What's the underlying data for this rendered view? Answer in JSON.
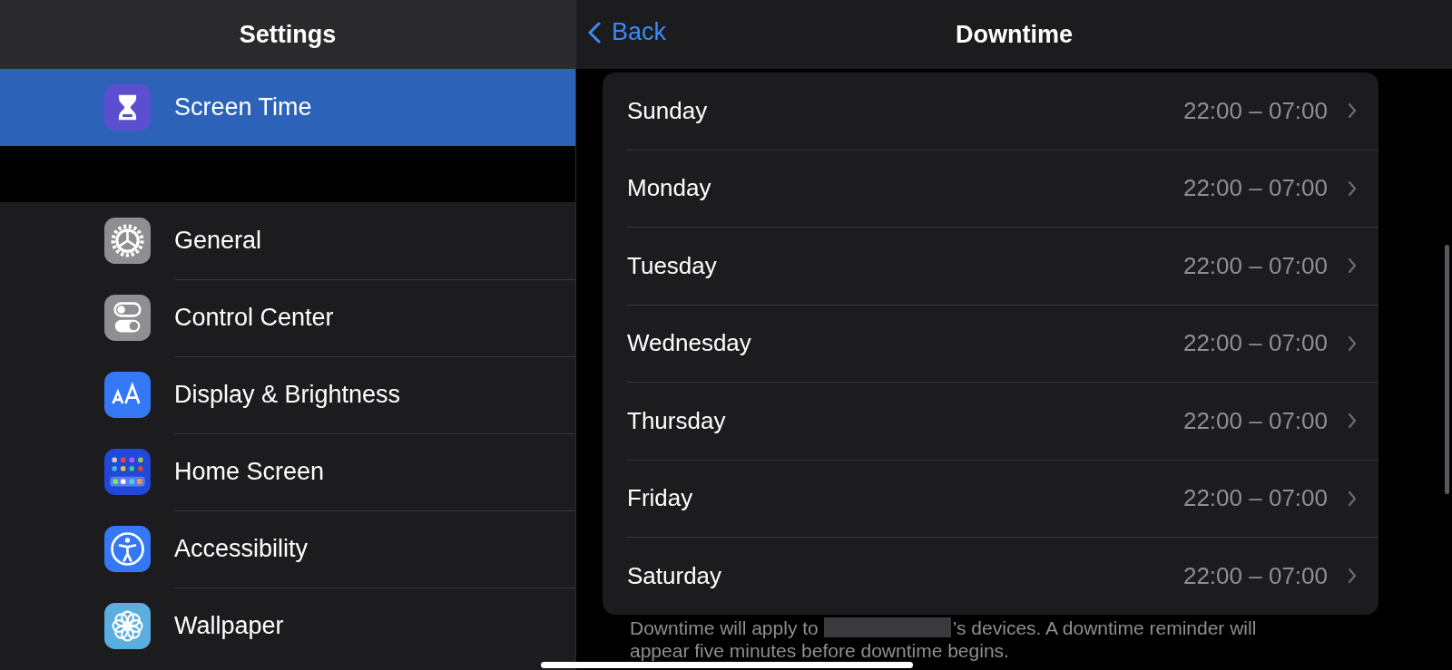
{
  "sidebar": {
    "title": "Settings",
    "groups": [
      [
        {
          "label": "Screen Time",
          "kind": "screen-time",
          "selected": true
        }
      ],
      [
        {
          "label": "General",
          "kind": "general",
          "selected": false
        },
        {
          "label": "Control Center",
          "kind": "control-center",
          "selected": false
        },
        {
          "label": "Display & Brightness",
          "kind": "display",
          "selected": false
        },
        {
          "label": "Home Screen",
          "kind": "home-screen",
          "selected": false
        },
        {
          "label": "Accessibility",
          "kind": "accessibility",
          "selected": false
        },
        {
          "label": "Wallpaper",
          "kind": "wallpaper",
          "selected": false
        }
      ]
    ]
  },
  "detail": {
    "back": "Back",
    "title": "Downtime",
    "days": [
      {
        "day": "Sunday",
        "time": "22:00 – 07:00"
      },
      {
        "day": "Monday",
        "time": "22:00 – 07:00"
      },
      {
        "day": "Tuesday",
        "time": "22:00 – 07:00"
      },
      {
        "day": "Wednesday",
        "time": "22:00 – 07:00"
      },
      {
        "day": "Thursday",
        "time": "22:00 – 07:00"
      },
      {
        "day": "Friday",
        "time": "22:00 – 07:00"
      },
      {
        "day": "Saturday",
        "time": "22:00 – 07:00"
      }
    ],
    "footer": {
      "before": "Downtime will apply to",
      "after": "’s devices. A downtime reminder will",
      "continued": "appear five minutes before downtime begins."
    }
  }
}
